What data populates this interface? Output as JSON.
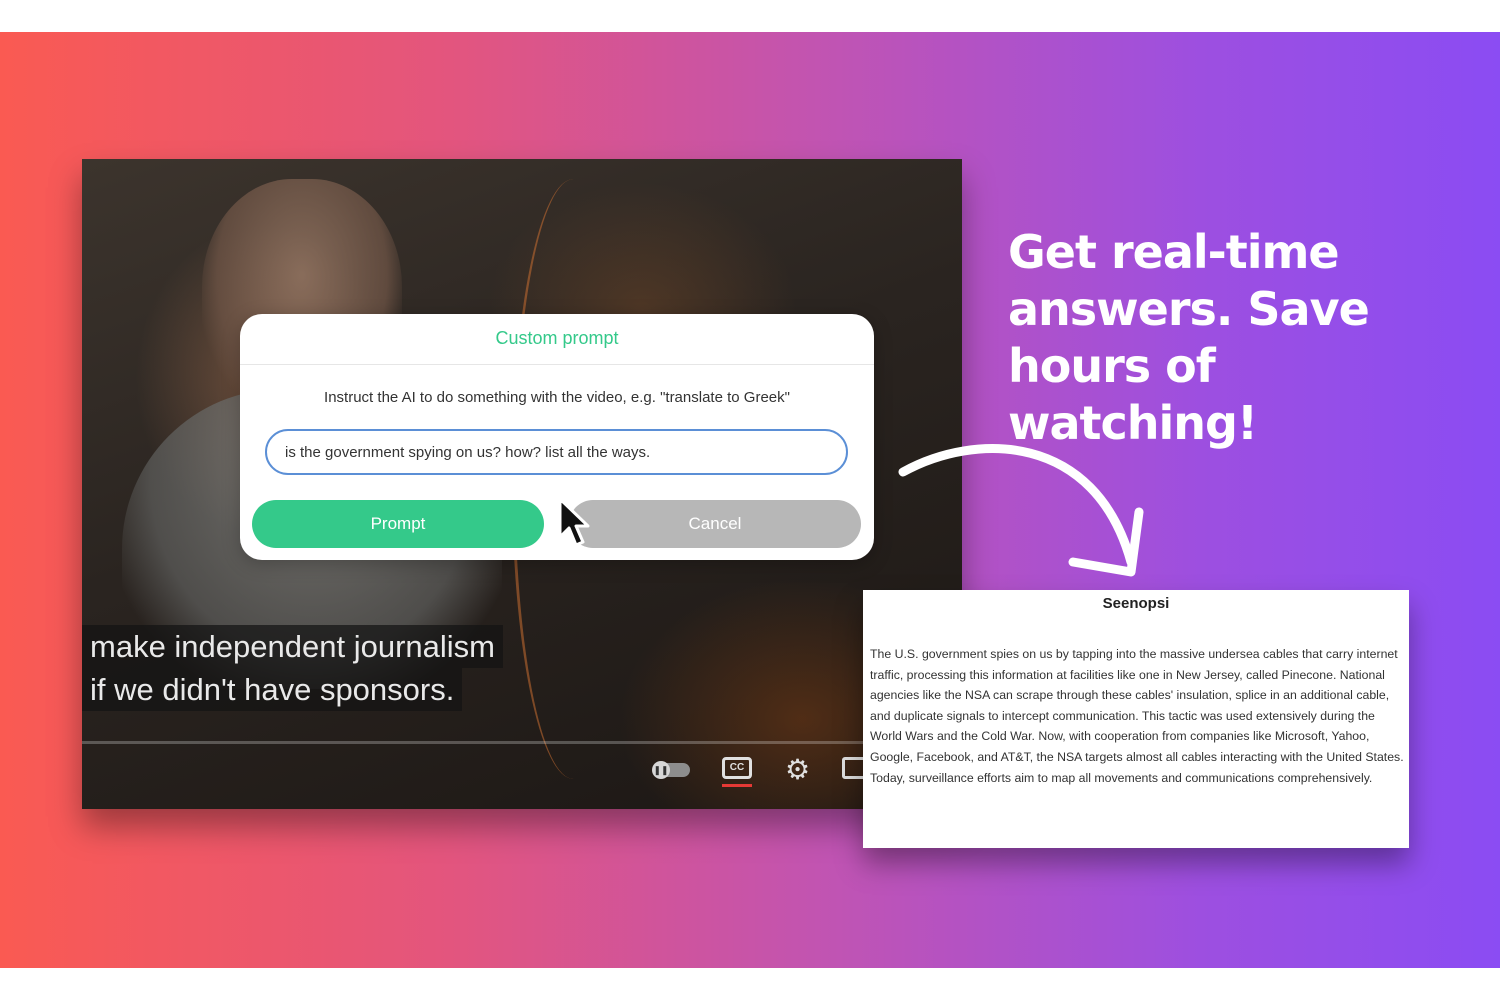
{
  "video": {
    "caption_lines": [
      "make independent journalism",
      "if we didn't have sponsors."
    ],
    "controls": {
      "autoplay_icon": "pause-icon",
      "cc_label": "CC",
      "settings_icon": "gear-icon",
      "miniplayer_icon": "miniplayer-icon"
    }
  },
  "dialog": {
    "title": "Custom prompt",
    "hint": "Instruct the AI to do something with the video, e.g. \"translate to Greek\"",
    "input_value": "is the government spying on us? how? list all the ways.",
    "prompt_button": "Prompt",
    "cancel_button": "Cancel"
  },
  "headline": "Get real-time answers. Save hours of watching!",
  "summary": {
    "title": "Seenopsi",
    "body": "The U.S. government spies on us by tapping into the massive undersea cables that carry internet traffic, processing this information at facilities like one in New Jersey, called Pinecone. National agencies like the NSA can scrape through these cables' insulation, splice in an additional cable, and duplicate signals to intercept communication. This tactic was used extensively during the World Wars and the Cold War. Now, with cooperation from companies like Microsoft, Yahoo, Google, Facebook, and AT&T, the NSA targets almost all cables interacting with the United States. Today, surveillance efforts aim to map all movements and communications comprehensively."
  },
  "colors": {
    "accent_green": "#34c98a",
    "cancel_gray": "#b7b7b7",
    "input_border": "#5b8fd6",
    "gradient_start": "#fa5a52",
    "gradient_end": "#8b4cf3"
  }
}
